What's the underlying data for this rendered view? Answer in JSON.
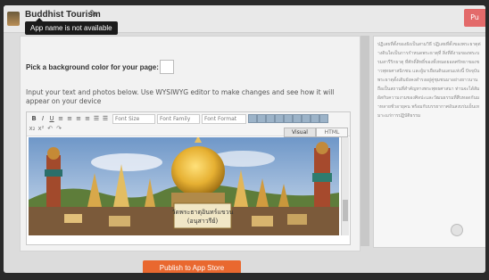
{
  "app": {
    "title": "Buddhist Tourism",
    "tooltip": "App name is not available",
    "top_right_button_label": "Pu"
  },
  "editor_panel": {
    "background_label": "Pick a background color for your page:",
    "instructions": "Input your text and photos below. Use WYSIWYG editor to make changes and see how it will appear on your device",
    "toolbar": {
      "bold": "B",
      "italic": "I",
      "underline": "U",
      "font_size": "Font Size",
      "font_family": "Font Family",
      "font_format": "Font Format"
    },
    "tabs": [
      "Visual",
      "HTML"
    ],
    "photo_sign_text": [
      "วัดพระธาตุอินทร์แขวน",
      "(อนุสาวรีย์)"
    ]
  },
  "right_panel": {
    "text": "ปฏิเสธที่ตั้งของยังเป็นสามวิธี ปฏิเสธที่ตั้งของพระธาตุต่างดินใดเป็นการกำหนดพระธาตุที่ สิ่งที่ดีงามของพระบรมสารีริกธาตุ ที่ศักดิ์สิทธิ์ของทั้งหมดยอดศรัทธาของชาวพุทธศาสนิกชน และผู้มาเยือนดินแดนแห่งนี้ ปัจจุบันพระธาตุดั้งเดิมยังคงดำรงอยู่คู่ชุมชนมาอย่างยาวนาน ถือเป็นสถานที่สำคัญทางพระพุทธศาสนา ท่านจะได้สัมผัสกับความงามของศิลปะและวัฒนธรรมที่สืบทอดกันมาหลายชั่วอายุคน พร้อมกับบรรยากาศอันสงบร่มเย็นเหมาะแก่การปฏิบัติธรรม"
  },
  "footer": {
    "publish_label": "Publish to App Store"
  },
  "colors": {
    "publish": "#e9682f",
    "tooltip_bg": "#1b1b1b",
    "top_right_button": "#e36a6a"
  }
}
